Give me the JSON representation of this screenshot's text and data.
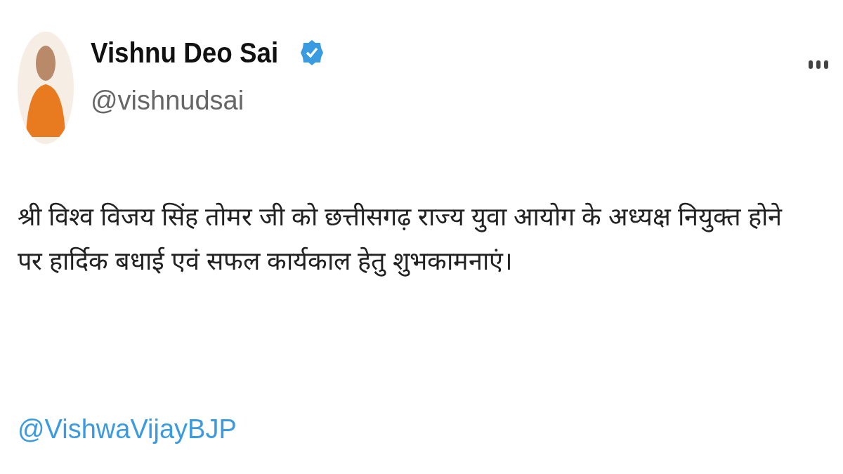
{
  "author": {
    "name": "Vishnu Deo Sai",
    "verified": true,
    "handle": "@vishnudsai"
  },
  "tweet": {
    "text": "श्री विश्व विजय सिंह तोमर जी को छत्तीसगढ़ राज्य युवा आयोग के अध्यक्ष नियुक्त होने पर हार्दिक बधाई एवं सफल कार्यकाल हेतु शुभकामनाएं।",
    "mention": "@VishwaVijayBJP"
  }
}
